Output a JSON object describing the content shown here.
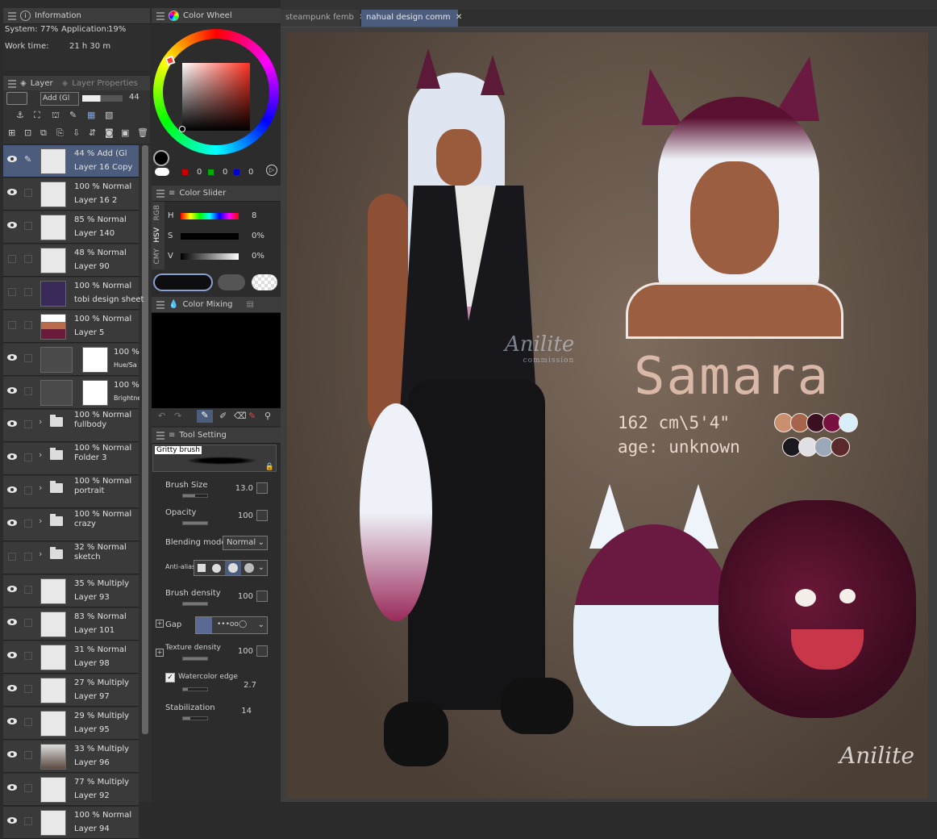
{
  "info": {
    "title": "Information",
    "system": "System:",
    "system_val": "77%",
    "app": "Application:",
    "app_val": "19%",
    "worktime": "Work time:",
    "worktime_val": "21 h 30 m"
  },
  "layer_panel": {
    "tab1": "Layer",
    "tab2": "Layer Properties",
    "blend": "Add (Gl",
    "opacity": "44"
  },
  "layers": [
    {
      "line1": "44 % Add (Gl",
      "line2": "Layer 16 Copy",
      "selected": true
    },
    {
      "line1": "100 % Normal",
      "line2": "Layer 16 2"
    },
    {
      "line1": "85 % Normal",
      "line2": "Layer 140"
    },
    {
      "line1": "48 % Normal",
      "line2": "Layer 90"
    },
    {
      "line1": "100 % Normal",
      "line2": "tobi design sheet"
    },
    {
      "line1": "100 % Normal",
      "line2": "Layer 5"
    },
    {
      "line1": "100 %",
      "line2": "Hue/Sa"
    },
    {
      "line1": "100 %",
      "line2": "Brightne"
    },
    {
      "line1": "100 % Normal",
      "line2": "fullbody"
    },
    {
      "line1": "100 % Normal",
      "line2": "Folder 3"
    },
    {
      "line1": "100 % Normal",
      "line2": "portrait"
    },
    {
      "line1": "100 % Normal",
      "line2": "crazy"
    },
    {
      "line1": "32 % Normal",
      "line2": "sketch"
    },
    {
      "line1": "35 % Multiply",
      "line2": "Layer 93"
    },
    {
      "line1": "83 % Normal",
      "line2": "Layer 101"
    },
    {
      "line1": "31 % Normal",
      "line2": "Layer 98"
    },
    {
      "line1": "27 % Multiply",
      "line2": "Layer 97"
    },
    {
      "line1": "29 % Multiply",
      "line2": "Layer 95"
    },
    {
      "line1": "33 % Multiply",
      "line2": "Layer 96"
    },
    {
      "line1": "77 % Multiply",
      "line2": "Layer 92"
    },
    {
      "line1": "100 % Normal",
      "line2": "Layer 94"
    }
  ],
  "color_wheel": {
    "title": "Color Wheel",
    "r": "0",
    "g": "0",
    "b": "0"
  },
  "color_slider": {
    "title": "Color Slider",
    "tabs": [
      "RGB",
      "HSV",
      "CMY"
    ],
    "h_label": "H",
    "h_val": "8",
    "s_label": "S",
    "s_val": "0%",
    "v_label": "V",
    "v_val": "0%"
  },
  "color_mixing": {
    "title": "Color Mixing"
  },
  "tool_settings": {
    "title": "Tool Setting",
    "brush_name": "Gritty brush",
    "brush_size_label": "Brush Size",
    "brush_size": "13.0",
    "opacity_label": "Opacity",
    "opacity": "100",
    "blend_label": "Blending mode",
    "blend": "Normal",
    "antialias_label": "Anti-alias",
    "density_label": "Brush density",
    "density": "100",
    "gap_label": "Gap",
    "texture_label": "Texture density",
    "texture": "100",
    "watercolor_label": "Watercolor edge",
    "watercolor": "2.7",
    "stabilization_label": "Stabilization",
    "stabilization": "14"
  },
  "doc_tabs": [
    {
      "label": "steampunk femb",
      "active": false
    },
    {
      "label": "nahual design comm",
      "active": true
    }
  ],
  "artwork": {
    "name": "Samara",
    "height": "162 cm\\5'4\"",
    "age": "age: unknown",
    "watermark": "Anilite",
    "watermark_sub": "commission",
    "palette_row1": [
      "#c98f6e",
      "#a8644a",
      "#3a1020",
      "#7a1040",
      "#d8eef8"
    ],
    "palette_row2": [
      "#1a1a1e",
      "#e0e0e4",
      "#9aa8b8",
      "#5a2a2a"
    ]
  },
  "colors": {
    "accent": "#4c5c7c",
    "bg": "#2b2b2b"
  }
}
